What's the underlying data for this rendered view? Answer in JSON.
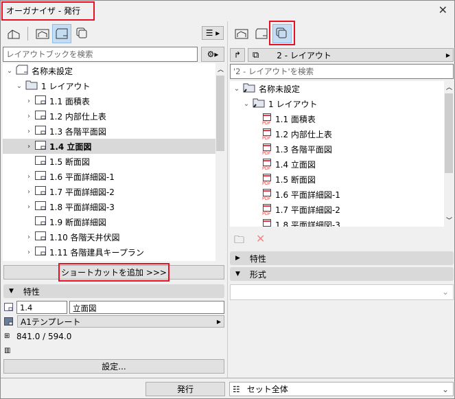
{
  "window": {
    "title": "オーガナイザ - 発行",
    "close": "✕"
  },
  "left": {
    "search_placeholder": "レイアウトブックを検索",
    "tree": [
      {
        "label": "名称未設定",
        "level": 0,
        "expand": "⌄"
      },
      {
        "label": "1 レイアウト",
        "level": 1,
        "expand": "⌄"
      },
      {
        "label": "1.1 面積表",
        "level": 2,
        "expand": "›"
      },
      {
        "label": "1.2 内部仕上表",
        "level": 2,
        "expand": "›"
      },
      {
        "label": "1.3 各階平面図",
        "level": 2,
        "expand": "›"
      },
      {
        "label": "1.4 立面図",
        "level": 2,
        "expand": "›",
        "selected": true
      },
      {
        "label": "1.5 断面図",
        "level": 2,
        "expand": ""
      },
      {
        "label": "1.6 平面詳細図-1",
        "level": 2,
        "expand": "›"
      },
      {
        "label": "1.7 平面詳細図-2",
        "level": 2,
        "expand": "›"
      },
      {
        "label": "1.8 平面詳細図-3",
        "level": 2,
        "expand": "›"
      },
      {
        "label": "1.9 断面詳細図",
        "level": 2,
        "expand": ""
      },
      {
        "label": "1.10 各階天井伏図",
        "level": 2,
        "expand": "›"
      },
      {
        "label": "1.11 各階建具キープラン",
        "level": 2,
        "expand": "›"
      }
    ],
    "add_shortcut": "ショートカットを追加 >>>",
    "properties": {
      "header": "特性",
      "id": "1.4",
      "name": "立面図",
      "template": "A1テンプレート",
      "size": "841.0 / 594.0",
      "settings": "設定..."
    },
    "publish": "発行"
  },
  "right": {
    "nav_label": "2 - レイアウト",
    "search_placeholder": "'2 - レイアウト'を検索",
    "tree": [
      {
        "label": "名称未設定",
        "level": 0
      },
      {
        "label": "1 レイアウト",
        "level": 1
      },
      {
        "label": "1.1 面積表",
        "level": 2
      },
      {
        "label": "1.2 内部仕上表",
        "level": 2
      },
      {
        "label": "1.3 各階平面図",
        "level": 2
      },
      {
        "label": "1.4 立面図",
        "level": 2
      },
      {
        "label": "1.5 断面図",
        "level": 2
      },
      {
        "label": "1.6 平面詳細図-1",
        "level": 2
      },
      {
        "label": "1.7 平面詳細図-2",
        "level": 2
      },
      {
        "label": "1.8 平面詳細図-3",
        "level": 2
      }
    ],
    "pdf_label": "PDF",
    "properties_header": "特性",
    "format_header": "形式",
    "set_select": "セット全体"
  }
}
